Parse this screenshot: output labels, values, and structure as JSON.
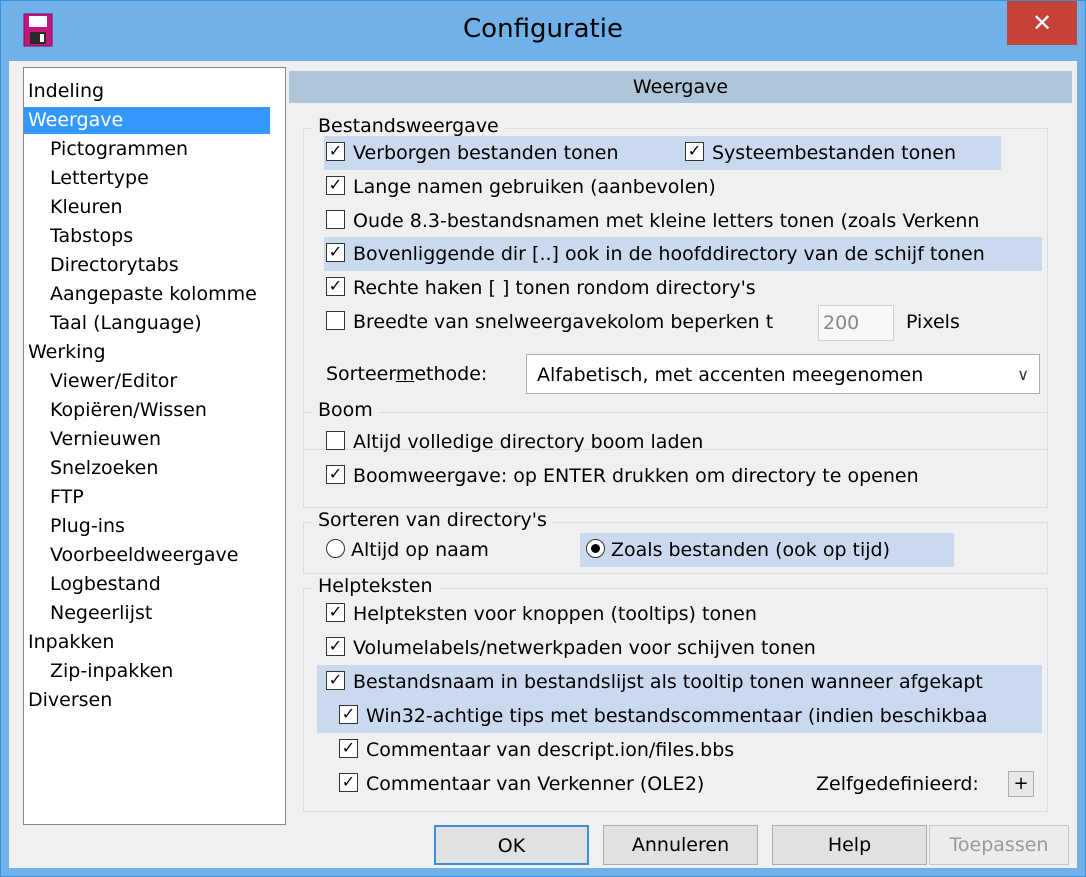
{
  "window": {
    "title": "Configuratie",
    "close_glyph": "✕",
    "accent_color": "#6fb1e8"
  },
  "tree": {
    "items": [
      {
        "label": "Indeling",
        "level": 0,
        "selected": false
      },
      {
        "label": "Weergave",
        "level": 0,
        "selected": true
      },
      {
        "label": "Pictogrammen",
        "level": 1,
        "selected": false
      },
      {
        "label": "Lettertype",
        "level": 1,
        "selected": false
      },
      {
        "label": "Kleuren",
        "level": 1,
        "selected": false
      },
      {
        "label": "Tabstops",
        "level": 1,
        "selected": false
      },
      {
        "label": "Directorytabs",
        "level": 1,
        "selected": false
      },
      {
        "label": "Aangepaste kolomme",
        "level": 1,
        "selected": false
      },
      {
        "label": "Taal (Language)",
        "level": 1,
        "selected": false
      },
      {
        "label": "Werking",
        "level": 0,
        "selected": false
      },
      {
        "label": "Viewer/Editor",
        "level": 1,
        "selected": false
      },
      {
        "label": "Kopiëren/Wissen",
        "level": 1,
        "selected": false
      },
      {
        "label": "Vernieuwen",
        "level": 1,
        "selected": false
      },
      {
        "label": "Snelzoeken",
        "level": 1,
        "selected": false
      },
      {
        "label": "FTP",
        "level": 1,
        "selected": false
      },
      {
        "label": "Plug-ins",
        "level": 1,
        "selected": false
      },
      {
        "label": "Voorbeeldweergave",
        "level": 1,
        "selected": false
      },
      {
        "label": "Logbestand",
        "level": 1,
        "selected": false
      },
      {
        "label": "Negeerlijst",
        "level": 1,
        "selected": false
      },
      {
        "label": "Inpakken",
        "level": 0,
        "selected": false
      },
      {
        "label": "Zip-inpakken",
        "level": 1,
        "selected": false
      },
      {
        "label": "Diversen",
        "level": 0,
        "selected": false
      }
    ]
  },
  "page": {
    "header": "Weergave",
    "bestandsweergave": {
      "title": "Bestandsweergave",
      "verborgen": {
        "label": "Verborgen bestanden tonen",
        "checked": true
      },
      "systeem": {
        "label": "Systeembestanden tonen",
        "checked": true
      },
      "lange_namen": {
        "label": "Lange namen gebruiken (aanbevolen)",
        "checked": true
      },
      "oude_83": {
        "label": "Oude 8.3-bestandsnamen met kleine letters tonen (zoals Verkenn",
        "checked": false
      },
      "bovenliggende": {
        "label": "Bovenliggende dir [..] ook in de hoofddirectory van de schijf tonen",
        "checked": true
      },
      "rechte_haken": {
        "label": "Rechte haken [ ] tonen rondom directory's",
        "checked": true
      },
      "breedte": {
        "label": "Breedte van snelweergavekolom beperken t",
        "checked": false,
        "value": "200",
        "unit": "Pixels"
      },
      "sorteer_label_pre": "Sorteer",
      "sorteer_label_ul": "m",
      "sorteer_label_post": "ethode:",
      "sorteer_value": "Alfabetisch, met accenten meegenomen"
    },
    "boom": {
      "title": "Boom",
      "volledig": {
        "label": "Altijd volledige directory boom laden",
        "checked": false
      },
      "enter": {
        "label": "Boomweergave: op ENTER drukken om directory te openen",
        "checked": true
      }
    },
    "sorteren": {
      "title": "Sorteren van directory's",
      "naam": {
        "label": "Altijd op naam",
        "selected": false
      },
      "bestanden": {
        "label": "Zoals bestanden (ook op tijd)",
        "selected": true
      }
    },
    "helpteksten": {
      "title": "Helpteksten",
      "knoppen": {
        "label": "Helpteksten voor knoppen (tooltips) tonen",
        "checked": true
      },
      "volumelabels": {
        "label": "Volumelabels/netwerkpaden voor schijven tonen",
        "checked": true
      },
      "bestandsnaam": {
        "label": "Bestandsnaam in bestandslijst als tooltip tonen wanneer afgekapt",
        "checked": true
      },
      "win32": {
        "label": "Win32-achtige tips met bestandscommentaar (indien beschikbaa",
        "checked": true
      },
      "descript": {
        "label": "Commentaar van descript.ion/files.bbs",
        "checked": true
      },
      "verkenner": {
        "label": "Commentaar van Verkenner (OLE2)",
        "checked": true
      },
      "zelfgedefinieerd": "Zelfgedefinieerd:",
      "plus": "+"
    }
  },
  "buttons": {
    "ok": "OK",
    "annuleren": "Annuleren",
    "help": "Help",
    "toepassen": "Toepassen"
  }
}
